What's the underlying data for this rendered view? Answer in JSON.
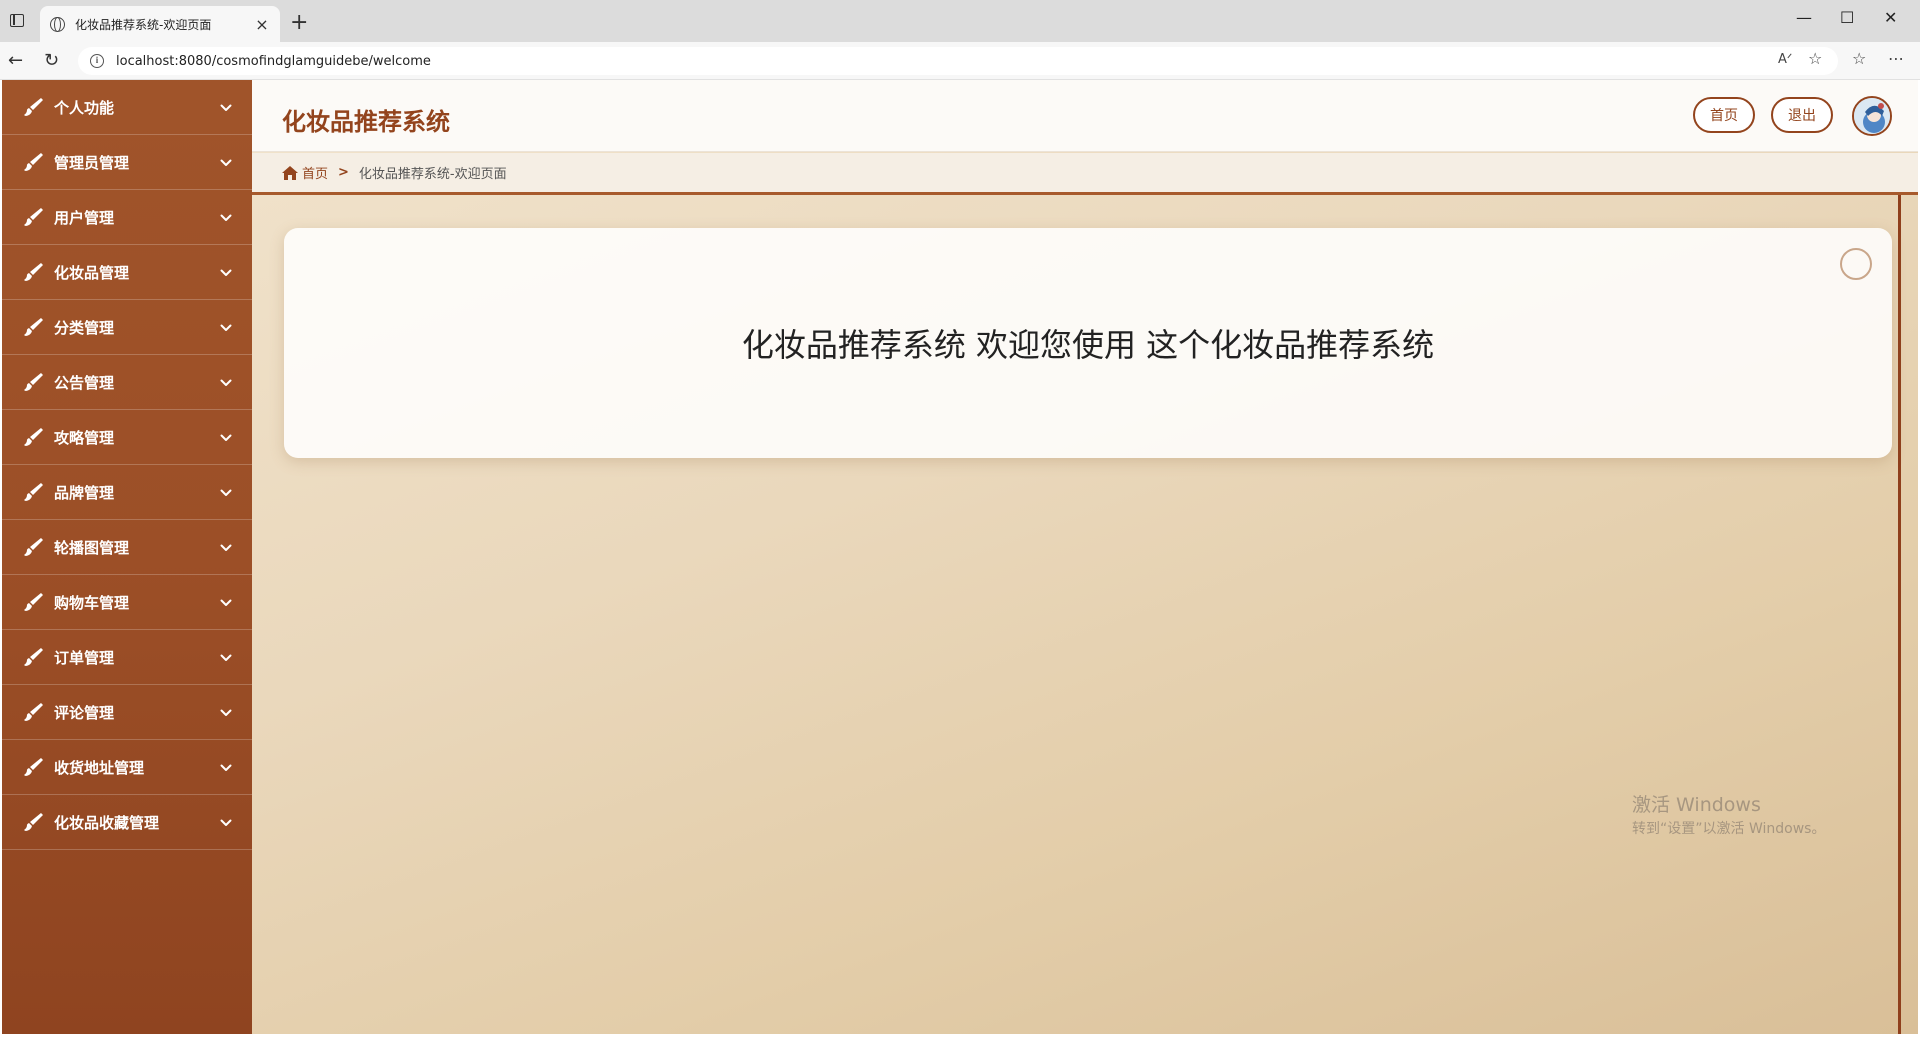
{
  "browser": {
    "tab_title": "化妆品推荐系统-欢迎页面",
    "url": "localhost:8080/cosmofindglamguidebe/welcome"
  },
  "sidebar": {
    "items": [
      {
        "label": "个人功能"
      },
      {
        "label": "管理员管理"
      },
      {
        "label": "用户管理"
      },
      {
        "label": "化妆品管理"
      },
      {
        "label": "分类管理"
      },
      {
        "label": "公告管理"
      },
      {
        "label": "攻略管理"
      },
      {
        "label": "品牌管理"
      },
      {
        "label": "轮播图管理"
      },
      {
        "label": "购物车管理"
      },
      {
        "label": "订单管理"
      },
      {
        "label": "评论管理"
      },
      {
        "label": "收货地址管理"
      },
      {
        "label": "化妆品收藏管理"
      }
    ]
  },
  "header": {
    "title": "化妆品推荐系统",
    "home_button": "首页",
    "logout_button": "退出"
  },
  "breadcrumb": {
    "home": "首页",
    "separator": ">",
    "current": "化妆品推荐系统-欢迎页面"
  },
  "main": {
    "welcome_text": "化妆品推荐系统 欢迎您使用 这个化妆品推荐系统"
  },
  "watermark": {
    "line1": "激活 Windows",
    "line2": "转到“设置”以激活 Windows。"
  },
  "colors": {
    "accent": "#93441d",
    "sidebar": "#9c4f27",
    "background": "#e8d5b7"
  }
}
